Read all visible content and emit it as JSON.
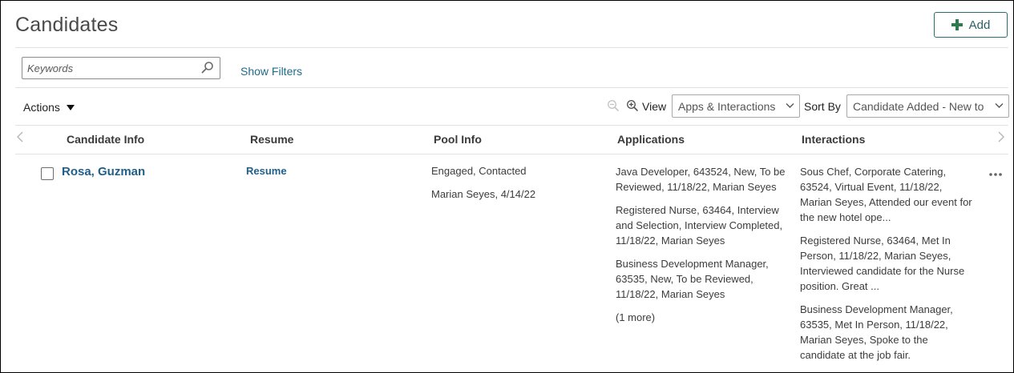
{
  "page": {
    "title": "Candidates",
    "add_label": "Add"
  },
  "search": {
    "placeholder": "Keywords",
    "value": ""
  },
  "filters": {
    "show_filters_label": "Show Filters"
  },
  "toolbar": {
    "actions_label": "Actions",
    "view_label": "View",
    "view_value": "Apps & Interactions",
    "sortby_label": "Sort By",
    "sort_value": "Candidate Added - New to"
  },
  "table": {
    "columns": [
      "Candidate Info",
      "Resume",
      "Pool Info",
      "Applications",
      "Interactions"
    ],
    "rows": [
      {
        "name": "Rosa, Guzman",
        "resume": "Resume",
        "pool_info": [
          "Engaged, Contacted",
          "Marian Seyes, 4/14/22"
        ],
        "applications": [
          "Java Developer, 643524, New, To be Reviewed, 11/18/22, Marian Seyes",
          "Registered Nurse, 63464, Interview and Selection, Interview Completed, 11/18/22, Marian Seyes",
          "Business Development Manager, 63535, New, To be Reviewed, 11/18/22, Marian Seyes",
          "(1 more)"
        ],
        "interactions": [
          "Sous Chef, Corporate Catering, 63524, Virtual Event, 11/18/22, Marian Seyes, Attended our event for the new hotel ope...",
          "Registered Nurse, 63464, Met In Person, 11/18/22, Marian Seyes, Interviewed candidate for the Nurse position. Great ...",
          "Business Development Manager, 63535, Met In Person, 11/18/22, Marian Seyes, Spoke to the candidate at the job fair."
        ]
      }
    ]
  },
  "icons": {
    "add": "plus-icon",
    "search": "search-icon",
    "actions": "caret-down-icon",
    "zoom_out": "zoom-out-icon",
    "zoom_in": "zoom-in-icon",
    "more": "more-icon"
  },
  "colors": {
    "link": "#1f5f8a",
    "accent_green": "#2d7a4e",
    "border": "#dfe3e6"
  }
}
